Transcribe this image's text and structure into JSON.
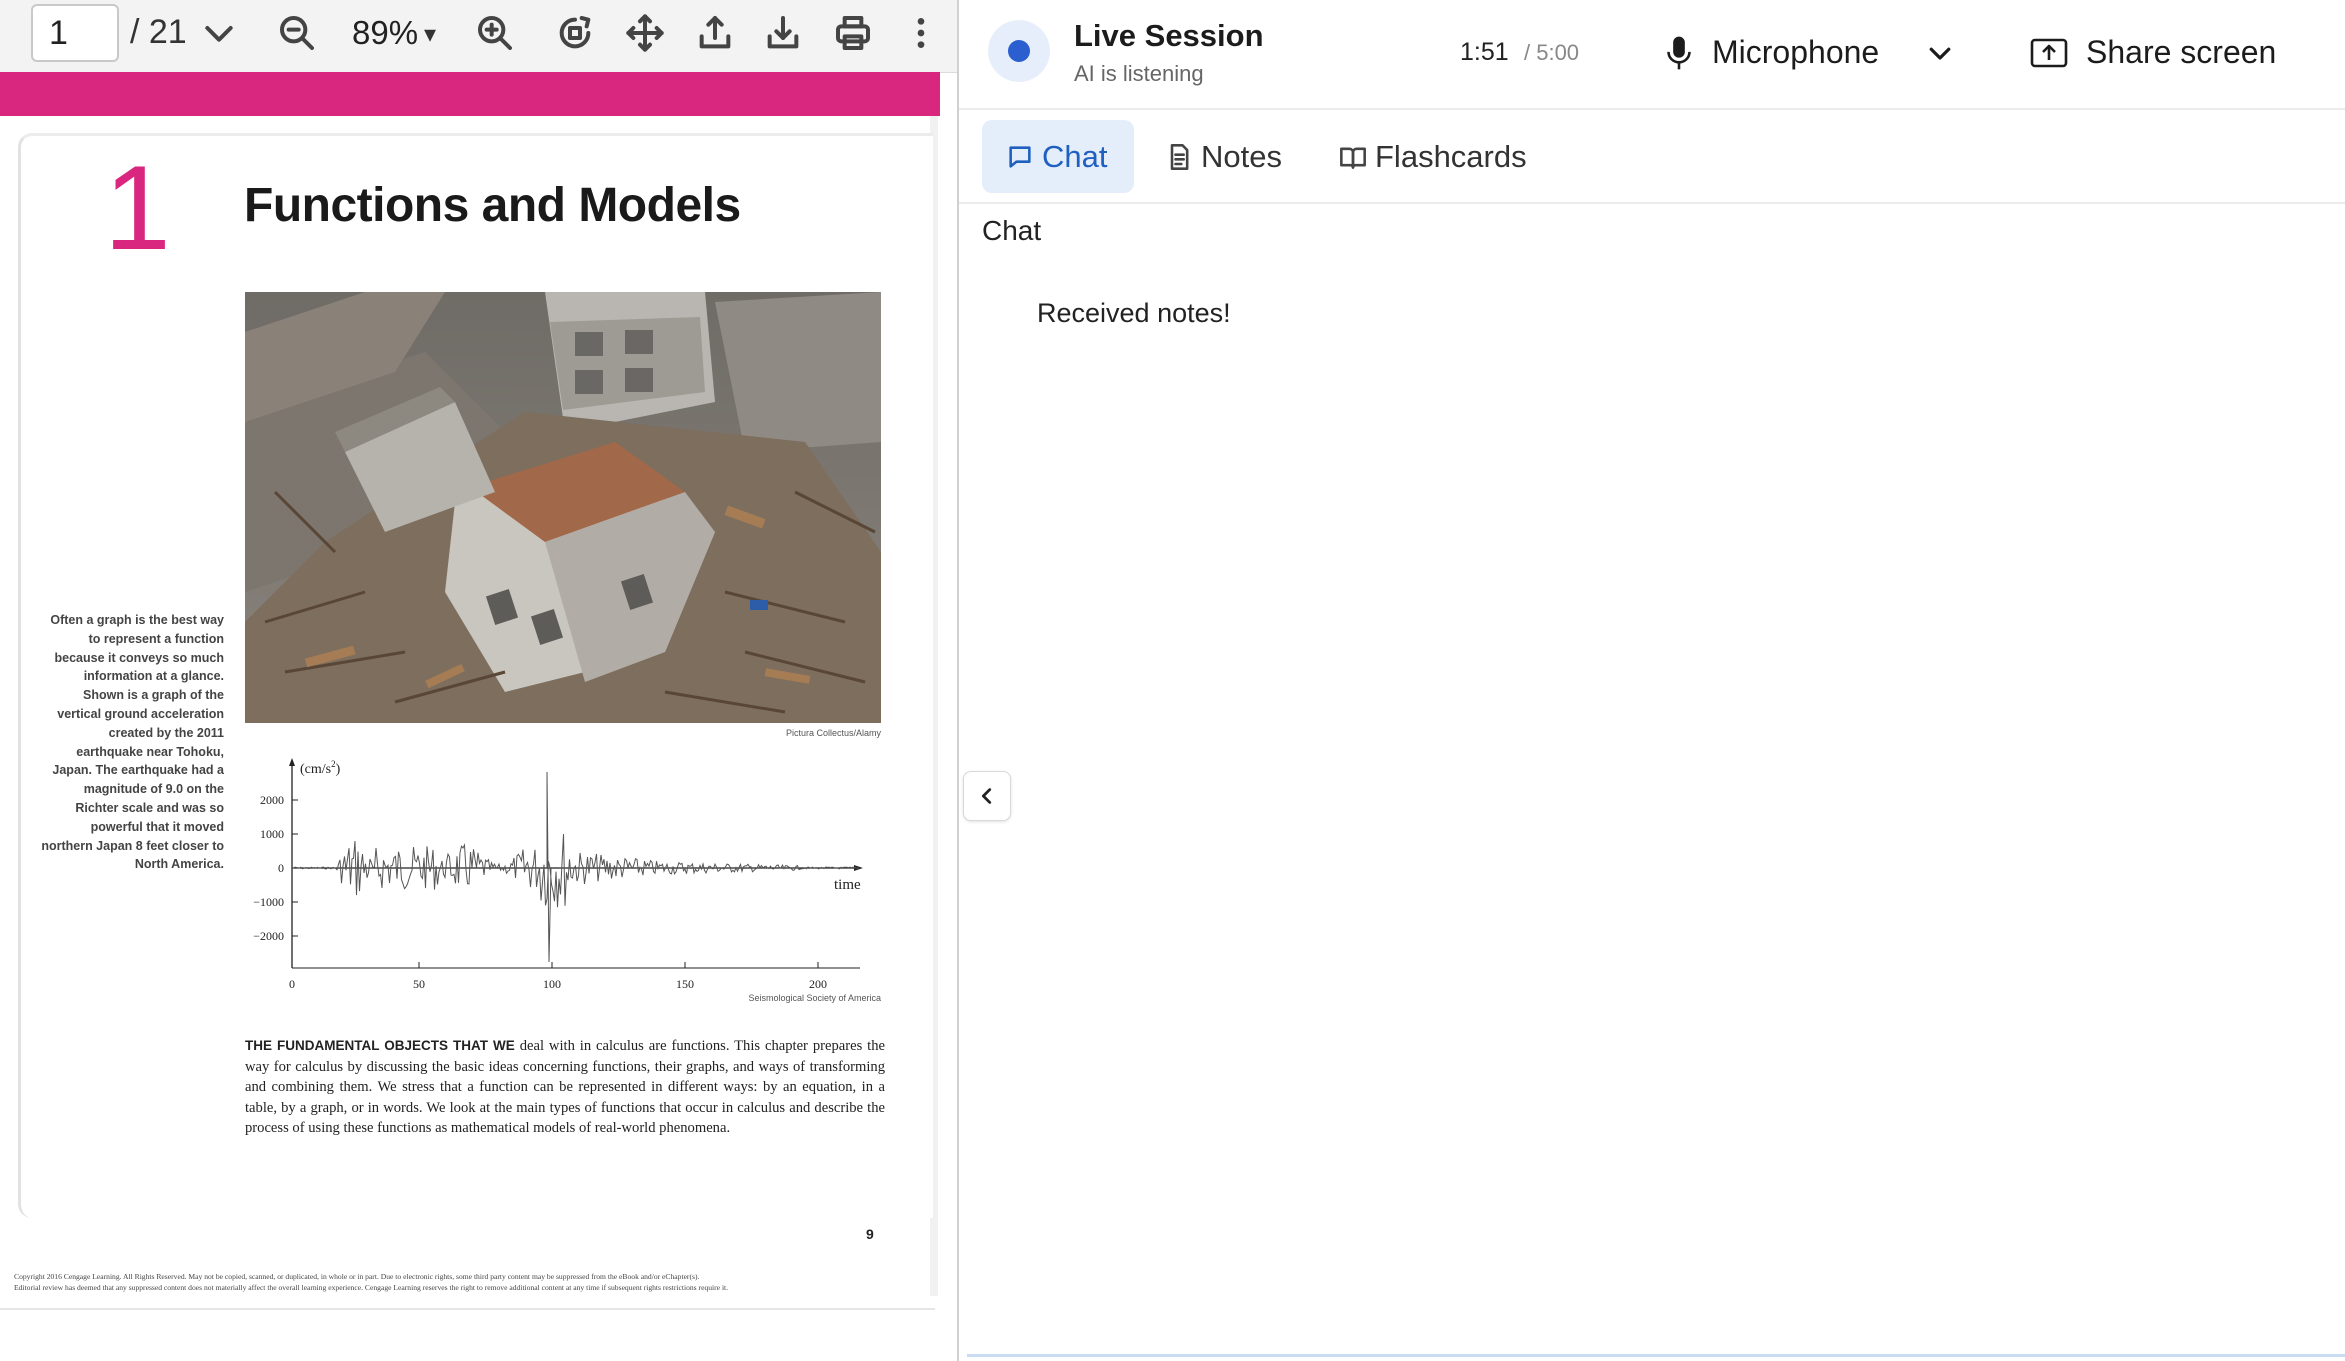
{
  "pdf_toolbar": {
    "page_current": "1",
    "page_total": "/ 21",
    "zoom": "89%",
    "zoom_caret": "▾"
  },
  "pdf_page": {
    "chapter_number": "1",
    "chapter_title": "Functions and Models",
    "photo_credit": "Pictura Collectus/Alamy",
    "caption": "Often a graph is the best way to represent a function because it conveys so much information at a glance. Shown is a graph of the vertical ground acceleration created by the 2011 earthquake near Tohoku, Japan. The earthquake had a magnitude of 9.0 on the Richter scale and was so powerful that it moved northern Japan 8 feet closer to North America.",
    "graph": {
      "y_unit": "(cm/s",
      "y_unit_exp": "2",
      "y_unit_close": ")",
      "y_ticks": [
        "2000",
        "1000",
        "0",
        "−1000",
        "−2000"
      ],
      "x_ticks": [
        "0",
        "50",
        "100",
        "150",
        "200"
      ],
      "x_label": "time",
      "credit": "Seismological Society of America"
    },
    "body_lead": "THE FUNDAMENTAL OBJECTS THAT WE",
    "body_text": " deal with in calculus are functions. This chapter prepares the way for calculus by discussing the basic ideas concerning functions, their graphs, and ways of transforming and combining them. We stress that a function can be represented in different ways: by an equation, in a table, by a graph, or in words. We look at the main types of functions that occur in calculus and describe the process of using these functions as mathematical models of real-world phenomena.",
    "page_number": "9",
    "copyright_line1": "Copyright 2016 Cengage Learning. All Rights Reserved. May not be copied, scanned, or duplicated, in whole or in part. Due to electronic rights, some third party content may be suppressed from the eBook and/or eChapter(s).",
    "copyright_line2": "Editorial review has deemed that any suppressed content does not materially affect the overall learning experience. Cengage Learning reserves the right to remove additional content at any time if subsequent rights restrictions require it."
  },
  "session": {
    "title": "Live Session",
    "status": "AI is listening",
    "timer_elapsed": "1:51",
    "timer_total": "/ 5:00",
    "microphone_label": "Microphone",
    "share_label": "Share screen",
    "tabs": [
      {
        "label": "Chat",
        "icon": "chat-bubble-icon",
        "active": true
      },
      {
        "label": "Notes",
        "icon": "document-icon",
        "active": false
      },
      {
        "label": "Flashcards",
        "icon": "book-icon",
        "active": false
      }
    ],
    "chat_heading": "Chat",
    "messages": [
      "Received notes!"
    ]
  },
  "colors": {
    "accent_pink": "#d9267f",
    "status_blue": "#2b5fd0",
    "active_tab_bg": "#e4edfa",
    "active_tab_text": "#1f5fbf"
  }
}
